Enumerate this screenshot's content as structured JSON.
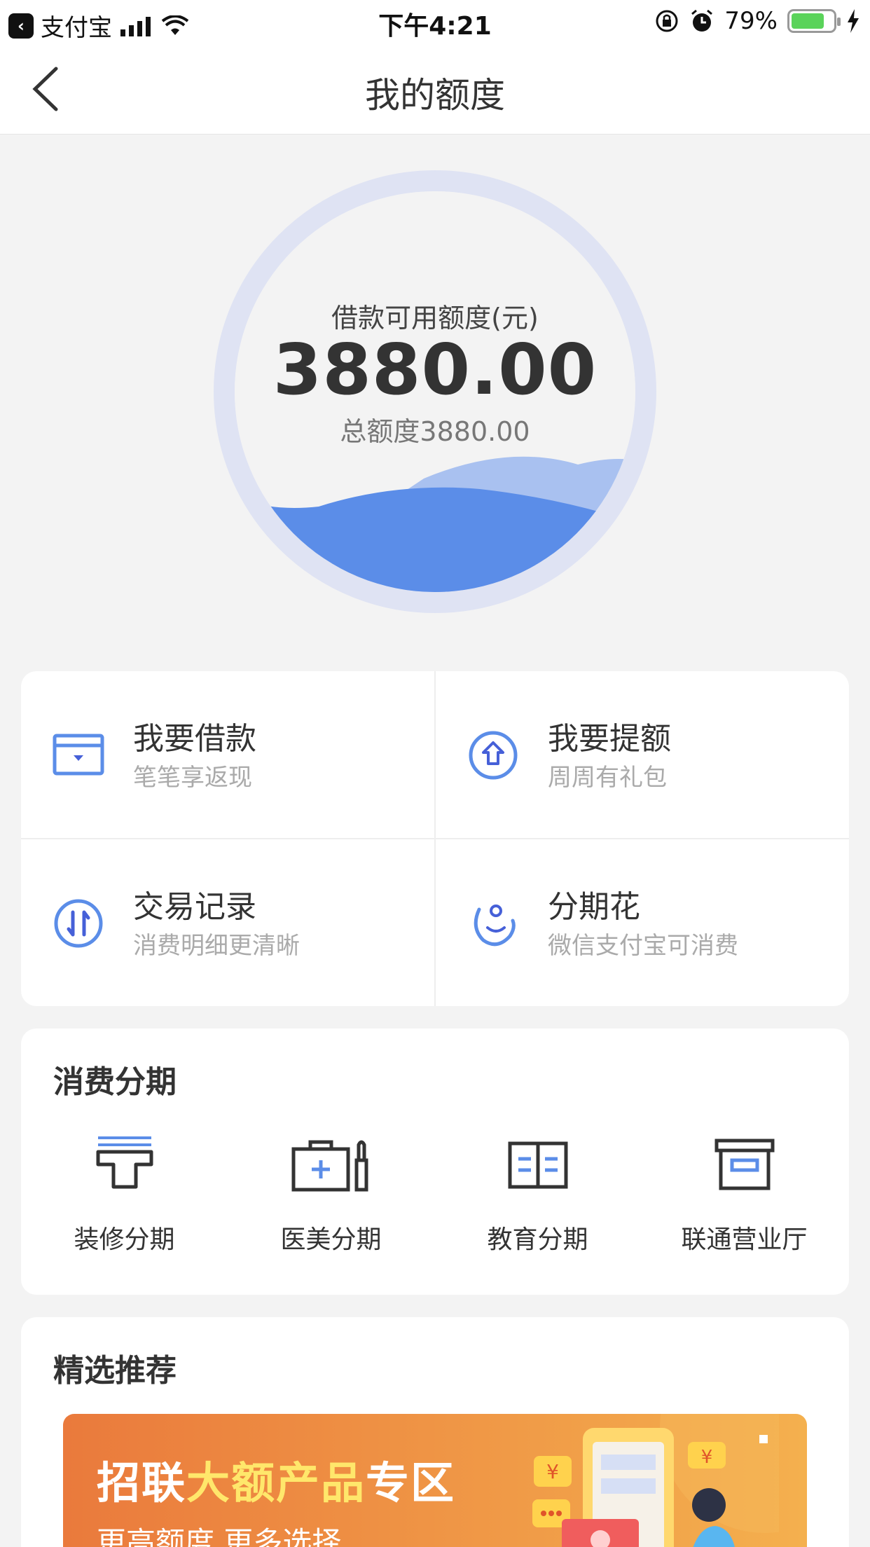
{
  "status_bar": {
    "back_app": "支付宝",
    "time": "下午4:21",
    "battery": "79%",
    "battery_level": 0.79
  },
  "nav": {
    "title": "我的额度"
  },
  "ring": {
    "label": "借款可用额度(元)",
    "amount": "3880.00",
    "total": "总额度3880.00"
  },
  "actions": [
    {
      "title": "我要借款",
      "sub": "笔笔享返现",
      "icon": "card-icon"
    },
    {
      "title": "我要提额",
      "sub": "周周有礼包",
      "icon": "arrow-up-circle-icon"
    },
    {
      "title": "交易记录",
      "sub": "消费明细更清晰",
      "icon": "transfer-circle-icon"
    },
    {
      "title": "分期花",
      "sub": "微信支付宝可消费",
      "icon": "smile-moon-icon"
    }
  ],
  "installment": {
    "title": "消费分期",
    "items": [
      {
        "label": "装修分期",
        "icon": "paint-roller-icon"
      },
      {
        "label": "医美分期",
        "icon": "medical-kit-icon"
      },
      {
        "label": "教育分期",
        "icon": "book-icon"
      },
      {
        "label": "联通营业厅",
        "icon": "store-box-icon"
      }
    ]
  },
  "recommend": {
    "title": "精选推荐",
    "banner_title_1": "招联",
    "banner_title_2": "大额产品",
    "banner_title_3": "专区",
    "banner_sub": "更高额度 更多选择"
  },
  "colors": {
    "accent": "#5b8de8",
    "ring": "#dfe3f3",
    "banner": "#ef8a40"
  }
}
